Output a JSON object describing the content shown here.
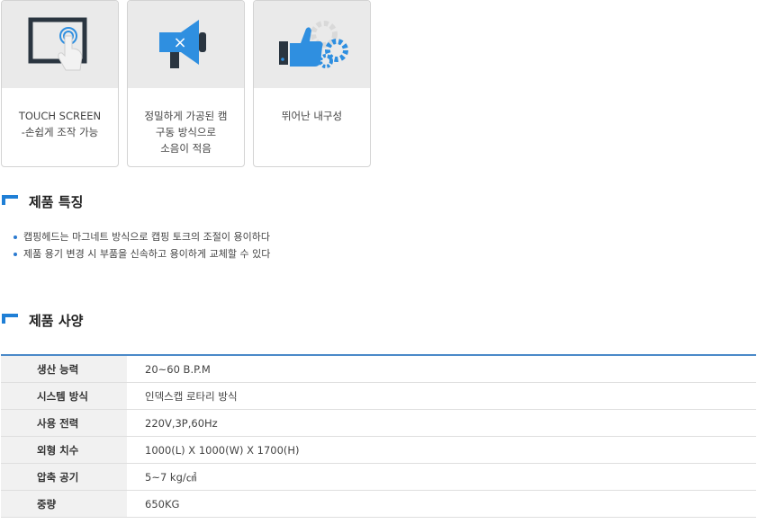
{
  "cards": [
    {
      "icon": "touch-screen-icon",
      "lines": [
        "TOUCH SCREEN",
        "-손쉽게 조작 가능"
      ]
    },
    {
      "icon": "megaphone-mute-icon",
      "lines": [
        "정밀하게 가공된 캠",
        "구동 방식으로",
        "소음이 적음"
      ]
    },
    {
      "icon": "thumbs-up-gears-icon",
      "lines": [
        "뛰어난 내구성"
      ]
    }
  ],
  "features": {
    "title": "제품 특징",
    "items": [
      "캡핑헤드는 마그네트 방식으로 캡핑 토크의 조절이 용이하다",
      "제품 용기 변경 시 부품을 신속하고 용이하게 교체할 수 있다"
    ]
  },
  "specs": {
    "title": "제품 사양",
    "rows": [
      {
        "label": "생산 능력",
        "value": "20~60 B.P.M"
      },
      {
        "label": "시스템 방식",
        "value": "인덱스캡 로타리 방식"
      },
      {
        "label": "사용 전력",
        "value": "220V,3P,60Hz"
      },
      {
        "label": "외형 치수",
        "value": "1000(L) X 1000(W) X 1700(H)"
      },
      {
        "label": "압축 공기",
        "value": "5~7 kg/㎠"
      },
      {
        "label": "중량",
        "value": "650KG"
      }
    ]
  },
  "colors": {
    "accent": "#1f7fd6",
    "icon_dark": "#2a3540",
    "icon_blue": "#2f8fe0"
  }
}
